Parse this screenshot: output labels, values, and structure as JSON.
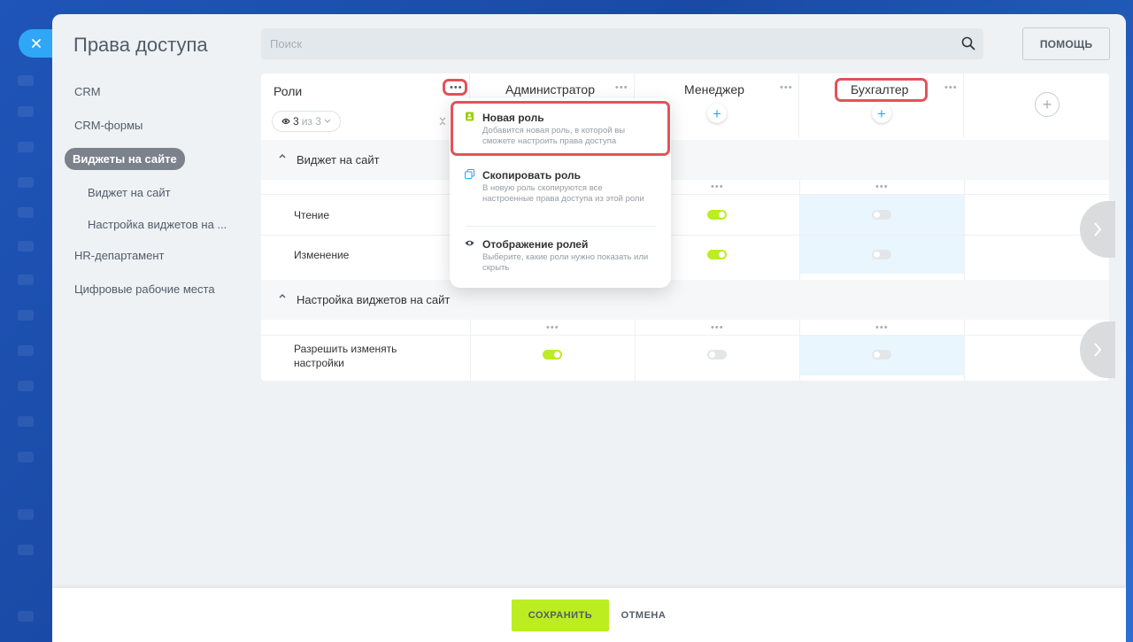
{
  "header": {
    "title": "Права доступа",
    "search_placeholder": "Поиск",
    "help_label": "ПОМОЩЬ"
  },
  "sidebar": {
    "items": [
      {
        "label": "CRM"
      },
      {
        "label": "CRM-формы"
      },
      {
        "label": "Виджеты на сайте",
        "active": true
      },
      {
        "label": "Виджет на сайт",
        "sub": true
      },
      {
        "label": "Настройка виджетов на ...",
        "sub": true
      },
      {
        "label": "HR-департамент"
      },
      {
        "label": "Цифровые рабочие места"
      }
    ]
  },
  "table": {
    "roles_header": "Роли",
    "counter": {
      "shown": "3",
      "of_label": "из 3"
    },
    "roles": [
      {
        "name": "Администратор"
      },
      {
        "name": "Менеджер"
      },
      {
        "name": "Бухгалтер"
      }
    ],
    "sections": [
      {
        "title": "Виджет на сайт",
        "rows": [
          {
            "label": "Чтение",
            "values": [
              true,
              true,
              false
            ]
          },
          {
            "label": "Изменение",
            "values": [
              true,
              true,
              false
            ]
          }
        ]
      },
      {
        "title": "Настройка виджетов на сайт",
        "rows": [
          {
            "label": "Разрешить изменять настройки",
            "values": [
              true,
              false,
              false
            ]
          }
        ]
      }
    ]
  },
  "menu": {
    "items": [
      {
        "title": "Новая роль",
        "description": "Добавится новая роль, в которой вы сможете настроить права доступа",
        "icon": "person-icon"
      },
      {
        "title": "Скопировать роль",
        "description": "В новую роль скопируются все настроенные права доступа из этой роли",
        "icon": "copy-icon"
      },
      {
        "title": "Отображение ролей",
        "description": "Выберите, какие роли нужно показать или скрыть",
        "icon": "eye-icon"
      }
    ]
  },
  "footer": {
    "save_label": "СОХРАНИТЬ",
    "cancel_label": "ОТМЕНА"
  },
  "colors": {
    "accent_green": "#bbed21",
    "accent_blue": "#2fa7f6",
    "highlight_red": "#e4525a",
    "highlight_column": "#eaf6fe"
  }
}
